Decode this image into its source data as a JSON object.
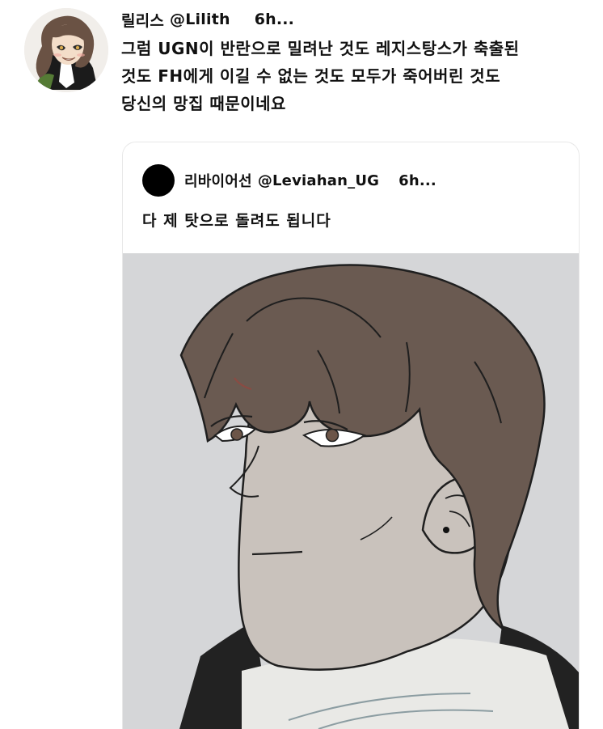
{
  "tweet": {
    "avatar_icon": "user-avatar-illustration",
    "display_name": "릴리스",
    "handle": "@Lilith",
    "time": "6h...",
    "text": "그럼 UGN이 반란으로 밀려난 것도 레지스탕스가 축출된\n것도 FH에게 이길 수 없는 것도 모두가 죽어버린 것도\n당신의 망집 때문이네요"
  },
  "quote": {
    "avatar_icon": "black-circle-avatar",
    "display_name": "리바이어선",
    "handle": "@Leviahan_UG",
    "time": "6h...",
    "text": "다 제 탓으로 돌려도 됩니다",
    "media_icon": "illustration-image"
  },
  "colors": {
    "text": "#111111",
    "card_border": "#e8e8e8",
    "media_background": "#d5d6d8",
    "hair_brown": "#6a5a51",
    "skin_gray": "#c9c2bc"
  }
}
